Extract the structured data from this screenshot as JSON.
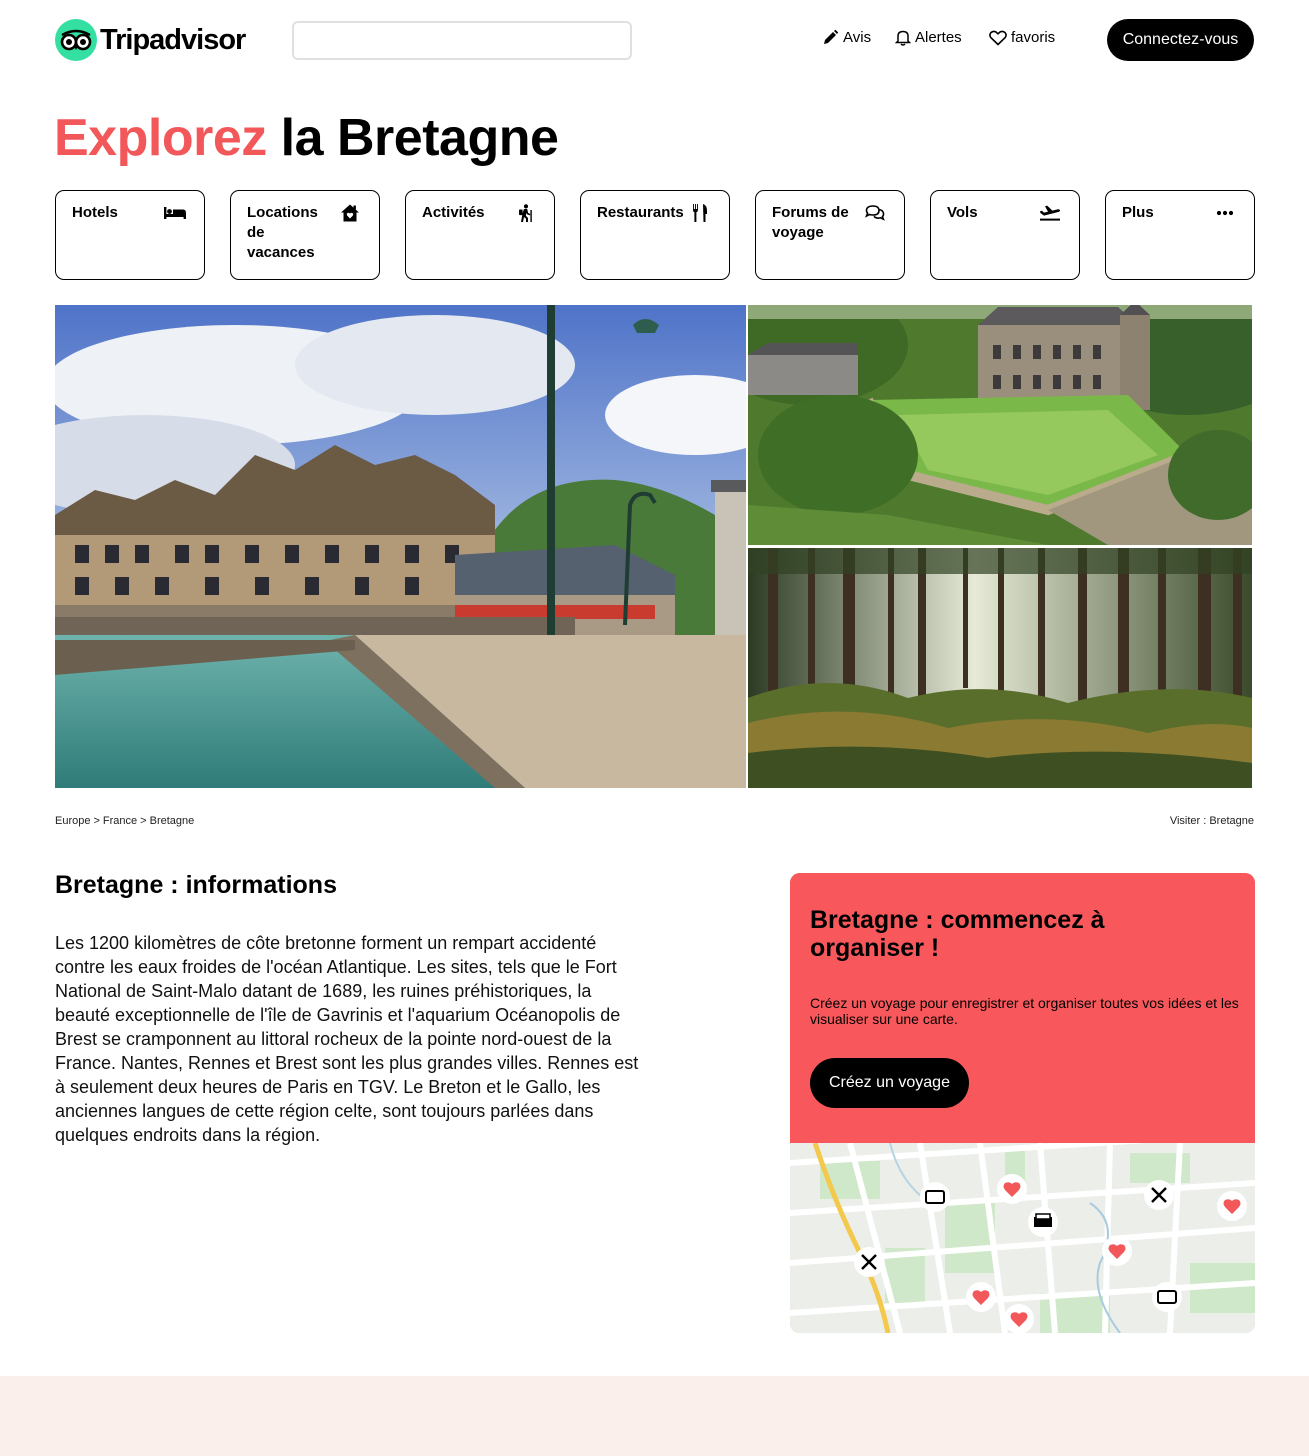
{
  "header": {
    "brand": "Tripadvisor",
    "search": {
      "value": "",
      "placeholder": ""
    },
    "nav": {
      "reviews": "Avis",
      "alerts": "Alertes",
      "favorites": "favoris"
    },
    "login": "Connectez-vous"
  },
  "hero": {
    "highlight": "Explorez",
    "rest": " la Bretagne"
  },
  "tiles": [
    {
      "label": "Hotels",
      "icon": "bed-icon"
    },
    {
      "label": "Locations de vacances",
      "icon": "house-icon"
    },
    {
      "label": "Activités",
      "icon": "hiker-icon"
    },
    {
      "label": "Restaurants",
      "icon": "cutlery-icon"
    },
    {
      "label": "Forums de voyage",
      "icon": "chat-bubbles-icon"
    },
    {
      "label": "Vols",
      "icon": "plane-icon"
    },
    {
      "label": "Plus",
      "icon": "more-icon"
    }
  ],
  "breadcrumb": [
    "Europe",
    "France",
    "Bretagne"
  ],
  "breadcrumb_separator": ">",
  "visit": "Visiter : Bretagne",
  "info": {
    "title": "Bretagne : informations",
    "text": "Les 1200 kilomètres de côte bretonne forment un rempart accidenté contre les eaux froides de l'océan Atlantique. Les sites, tels que le Fort National de Saint-Malo datant de 1689, les ruines préhistoriques, la beauté exceptionnelle de l'île de Gavrinis et l'aquarium Océanopolis de Brest se cramponnent au littoral rocheux de la pointe nord-ouest de la France. Nantes, Rennes et Brest sont les plus grandes villes. Rennes est à seulement deux heures de Paris en TGV. Le Breton et le Gallo, les anciennes langues de cette région celte, sont toujours parlées dans quelques endroits dans la région."
  },
  "trip": {
    "title": "Bretagne : commencez à organiser !",
    "text": "Créez un voyage pour enregistrer et organiser toutes vos idées et les visualiser sur une carte.",
    "button": "Créez un voyage"
  },
  "colors": {
    "brand_green": "#34e0a1",
    "accent_red": "#f2585a",
    "trip_card": "#f8585b",
    "footer_band": "#faefea"
  }
}
